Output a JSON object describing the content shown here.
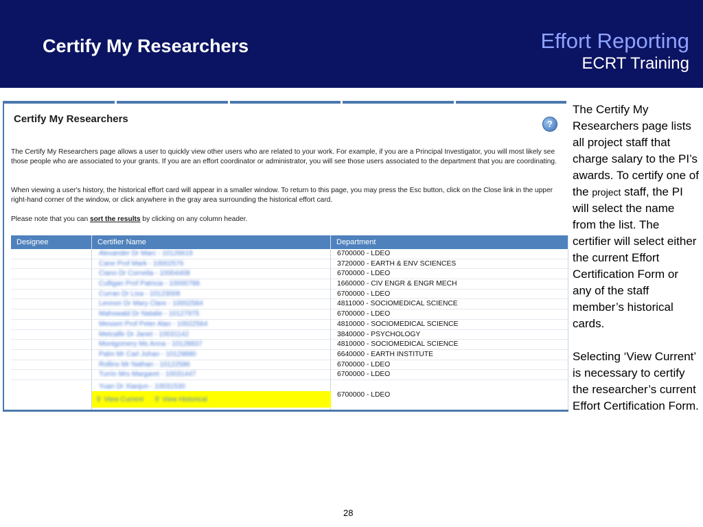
{
  "slide": {
    "title": "Certify My Researchers",
    "brand_line1": "Effort Reporting",
    "brand_line2": "ECRT Training",
    "page_number": "28"
  },
  "screenshot": {
    "title": "Certify My Researchers",
    "help_icon": "?",
    "paragraph1": "The Certify My Researchers page allows a user to quickly view other users who are related to your work. For example, if you are a Principal Investigator, you will most likely see those people who are associated to your grants. If you are an effort coordinator or administrator, you will see those users associated to the department that you are coordinating.",
    "paragraph2": "When viewing a user's history, the historical effort card will appear in a smaller window. To return to this page, you may press the Esc button, click on the Close link in the upper right-hand corner of the window, or click anywhere in the gray area surrounding the historical effort card.",
    "paragraph3_pre": "Please note that you can ",
    "paragraph3_link": "sort the results",
    "paragraph3_post": " by clicking on any column header.",
    "table": {
      "headers": [
        "Designee",
        "Certifier Name",
        "Department"
      ],
      "rows": [
        {
          "name": "Alexander Dr Marc - 10126619",
          "dept": "6700000 - LDEO"
        },
        {
          "name": "Cane Prof Mark - 10002576",
          "dept": "3720000 - EARTH & ENV SCIENCES"
        },
        {
          "name": "Ciano Dr Cornelia - 10004408",
          "dept": "6700000 - LDEO"
        },
        {
          "name": "Culligan Prof Patricia - 10000788",
          "dept": "1660000 - CIV ENGR & ENGR MECH"
        },
        {
          "name": "Curran Dr Lisa - 10123008",
          "dept": "6700000 - LDEO"
        },
        {
          "name": "Lennon Dr Mary Clare - 10002584",
          "dept": "4811000 - SOCIOMEDICAL SCIENCE"
        },
        {
          "name": "Mahowald Dr Natalie - 10127975",
          "dept": "6700000 - LDEO"
        },
        {
          "name": "Messeri Prof Peter Alan - 10022564",
          "dept": "4810000 - SOCIOMEDICAL SCIENCE"
        },
        {
          "name": "Metcalfe Dr Janet - 10031142",
          "dept": "3840000 - PSYCHOLOGY"
        },
        {
          "name": "Montgomery Ms Anna - 10128837",
          "dept": "4810000 - SOCIOMEDICAL SCIENCE"
        },
        {
          "name": "Palm Mr Carl Johan - 10129880",
          "dept": "6640000 - EARTH INSTITUTE"
        },
        {
          "name": "Rollins Mr Nathan - 10122586",
          "dept": "6700000 - LDEO"
        },
        {
          "name": "Turrin Mrs Margaret - 10031447",
          "dept": "6700000 - LDEO"
        }
      ],
      "last_row": {
        "name": "Yuan Dr Xiaojun - 10031530",
        "dept": "6700000 - LDEO",
        "view_current": "View Current",
        "view_historical": "View Historical"
      }
    }
  },
  "notes": {
    "p1_a": "The Certify My Researchers page lists all project staff that charge salary to the PI’s awards.  To certify one of the ",
    "p1_small": "project",
    "p1_b": " staff, the PI will select the name from the list. The certifier will select either the current Effort Certification Form or any of the staff member’s historical cards.",
    "p2": "Selecting ‘View Current’ is necessary to certify the researcher’s current Effort Certification Form."
  },
  "colors": {
    "header_bg": "#0b1462",
    "brand_accent": "#8fa2ff",
    "table_header": "#4f81bd",
    "action_highlight": "#ffff00"
  }
}
